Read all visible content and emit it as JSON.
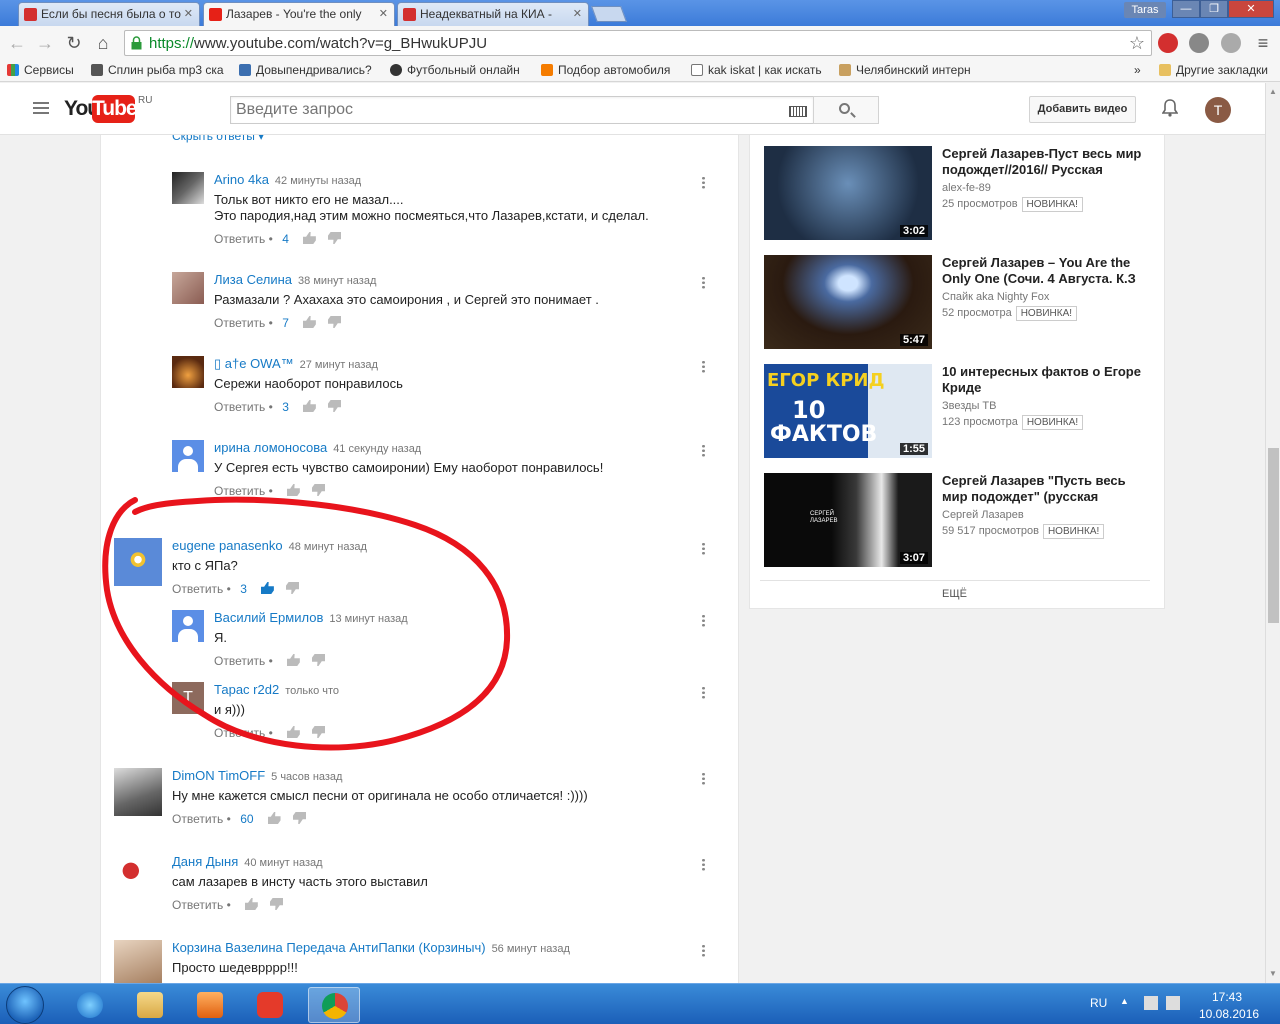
{
  "browser": {
    "tabs": [
      {
        "title": "Если бы песня была о то",
        "color": "#d32f2f"
      },
      {
        "title": "Лазарев - You're the only",
        "color": "#e62117"
      },
      {
        "title": "Неадекватный на КИА - ",
        "color": "#d32f2f"
      }
    ],
    "profile": "Taras",
    "url_scheme": "https://",
    "url_rest": "www.youtube.com/watch?v=g_BHwukUPJU",
    "bookmarks": [
      {
        "label": "Сервисы"
      },
      {
        "label": "Сплин рыба mp3 ска"
      },
      {
        "label": "Довыпендривались?"
      },
      {
        "label": "Футбольный онлайн"
      },
      {
        "label": "Подбор автомобиля"
      },
      {
        "label": "kak iskat | как искать"
      },
      {
        "label": "Челябинский интерн"
      }
    ],
    "more_bookmarks": "»",
    "other_bookmarks": "Другие закладки"
  },
  "youtube": {
    "logo_you": "You",
    "logo_tube": "Tube",
    "logo_region": "RU",
    "search_placeholder": "Введите запрос",
    "upload_label": "Добавить видео",
    "avatar_letter": "T"
  },
  "comments": {
    "hide_replies": "Скрыть ответы ▾",
    "reply_label": "Ответить",
    "dot": "•",
    "items": [
      {
        "author": "Arino 4ka",
        "time": "42 минуты назад",
        "lines": [
          "Тольк вот никто его не мазал....",
          "Это пародия,над этим можно посмеяться,что Лазарев,кстати, и сделал."
        ],
        "likes": "4"
      },
      {
        "author": "Лиза Селина",
        "time": "38 минут назад",
        "lines": [
          "Размазали ? Ахахаха это самоирония , и Сергей это понимает ."
        ],
        "likes": "7"
      },
      {
        "author": "▯ a†e OWA™",
        "time": "27 минут назад",
        "lines": [
          "Сережи наоборот понравилось"
        ],
        "likes": "3"
      },
      {
        "author": "ирина ломоносова",
        "time": "41 секунду назад",
        "lines": [
          "У Сергея есть чувство самоиронии) Ему наоборот понравилось!"
        ],
        "likes": ""
      },
      {
        "author": "eugene panasenko",
        "time": "48 минут назад",
        "lines": [
          "кто с ЯПа?"
        ],
        "likes": "3"
      },
      {
        "author": "Василий Ермилов",
        "time": "13 минут назад",
        "lines": [
          "Я."
        ],
        "likes": ""
      },
      {
        "author": "Тарас r2d2",
        "time": "только что",
        "lines": [
          "и я)))"
        ],
        "likes": "",
        "avatar_letter": "T"
      },
      {
        "author": "DimON TimOFF",
        "time": "5 часов назад",
        "lines": [
          "Ну мне кажется смысл песни от оригинала не особо отличается! :))))"
        ],
        "likes": "60"
      },
      {
        "author": "Даня Дыня",
        "time": "40 минут назад",
        "lines": [
          "сам лазарев в инсту часть этого выставил"
        ],
        "likes": ""
      },
      {
        "author": "Корзина Вазелина Передача АнтиПапки (Корзиныч)",
        "time": "56 минут назад",
        "lines": [
          "Просто шедеврррр!!!"
        ],
        "likes": ""
      }
    ]
  },
  "sidebar": {
    "videos": [
      {
        "title": "Сергей Лазарев-Пуст весь мир подождет//2016// Русская",
        "channel": "alex-fe-89",
        "views": "25 просмотров",
        "badge": "НОВИНКА!",
        "duration": "3:02"
      },
      {
        "title": "Сергей Лазарев – You Are the Only One (Сочи. 4 Августа. К.З",
        "channel": "Спайк aka Nighty Fox",
        "views": "52 просмотра",
        "badge": "НОВИНКА!",
        "duration": "5:47"
      },
      {
        "title": "10 интересных фактов о Егоре Криде",
        "channel": "Звезды ТВ",
        "views": "123 просмотра",
        "badge": "НОВИНКА!",
        "duration": "1:55",
        "thumb_line1": "ЕГОР КРИД",
        "thumb_line2": "10",
        "thumb_line3": "ФАКТОВ"
      },
      {
        "title": "Сергей Лазарев \"Пусть весь мир подождет\" (русская",
        "channel": "Сергей Лазарев",
        "views": "59 517 просмотров",
        "badge": "НОВИНКА!",
        "duration": "3:07",
        "thumb_text": "СЕРГЕЙ ЛАЗАРЕВ"
      }
    ],
    "more": "ЕЩЁ"
  },
  "taskbar": {
    "lang": "RU",
    "time": "17:43",
    "date": "10.08.2016"
  },
  "colors": {
    "annotation": "#e8141c",
    "link": "#167ac6",
    "brand": "#e62117"
  }
}
